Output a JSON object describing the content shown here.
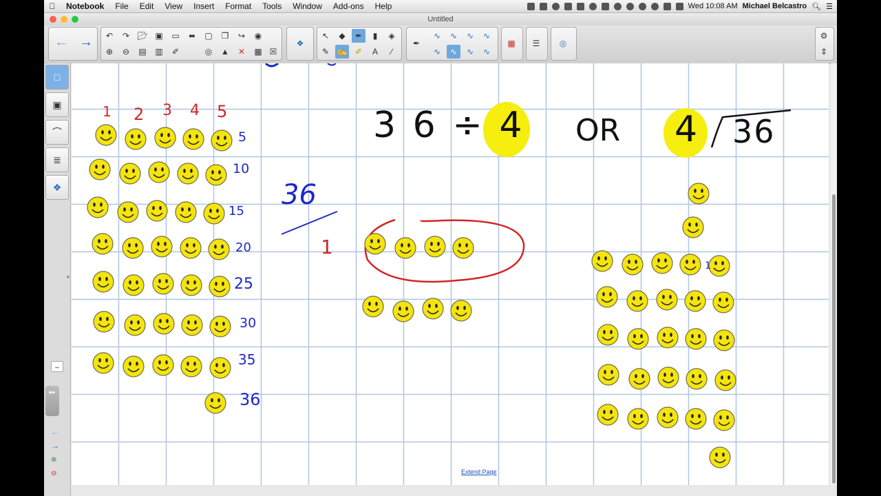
{
  "menubar": {
    "app_name": "Notebook",
    "items": [
      "File",
      "Edit",
      "View",
      "Insert",
      "Format",
      "Tools",
      "Window",
      "Add-ons",
      "Help"
    ],
    "clock": "Wed 10:08 AM",
    "user": "Michael Belcastro"
  },
  "window": {
    "title": "Untitled"
  },
  "canvas": {
    "extend_link": "Extend Page",
    "column_numbers": [
      "1",
      "2",
      "3",
      "4",
      "5"
    ],
    "count_labels": [
      "5",
      "10",
      "15",
      "20",
      "25",
      "30",
      "35",
      "36"
    ],
    "problem_left": "3 6 ÷ 4",
    "divisor_highlight": "4",
    "or_word": "OR",
    "long_div_divisor": "4",
    "long_div_dividend": "36",
    "fraction_numerator": "36",
    "group_number": "1",
    "right_group_mark": "1"
  },
  "colors": {
    "highlight": "#f5ee0e",
    "blue_ink": "#1d28c8",
    "red_ink": "#d22525",
    "smiley": "#f4e40f"
  }
}
